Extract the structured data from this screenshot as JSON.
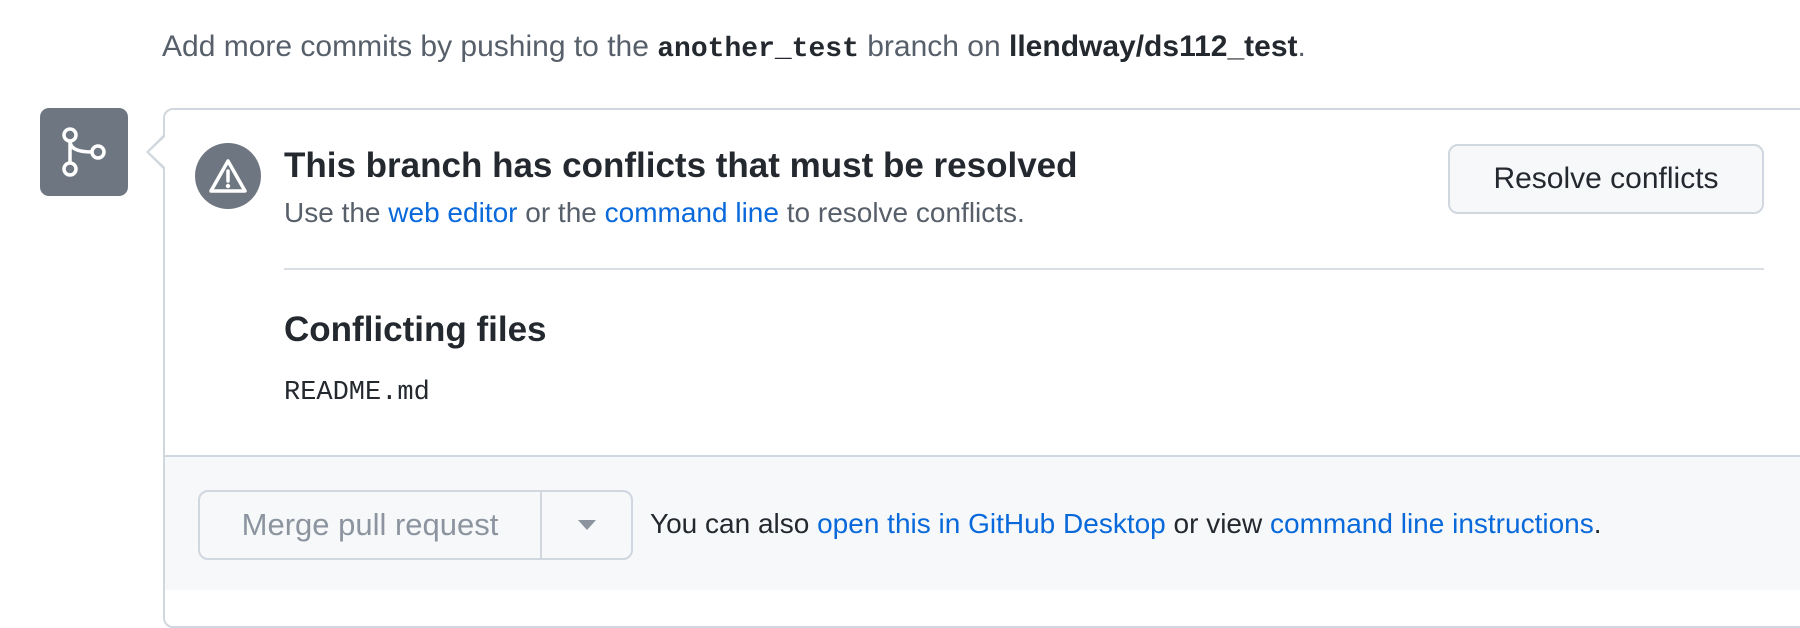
{
  "notice": {
    "prefix": "Add more commits by pushing to the",
    "branch": "another_test",
    "middle": "branch on",
    "repo": "llendway/ds112_test",
    "suffix": "."
  },
  "conflict": {
    "title": "This branch has conflicts that must be resolved",
    "sub_prefix": "Use the",
    "web_editor_link": "web editor",
    "sub_middle": "or the",
    "command_line_link": "command line",
    "sub_suffix": "to resolve conflicts.",
    "resolve_button": "Resolve conflicts"
  },
  "files": {
    "heading": "Conflicting files",
    "items": [
      "README.md"
    ]
  },
  "merge": {
    "button_label": "Merge pull request",
    "alt_prefix": "You can also",
    "desktop_link": "open this in GitHub Desktop",
    "alt_middle": "or view",
    "instructions_link": "command line instructions",
    "alt_suffix": "."
  },
  "icons": {
    "merge_badge": "git-merge-icon",
    "alert": "alert-triangle-icon",
    "dropdown": "triangle-down-icon"
  },
  "colors": {
    "link": "#0969da",
    "icon_bg": "#6e7781",
    "border": "#d0d7de",
    "muted_text": "#57606a"
  }
}
